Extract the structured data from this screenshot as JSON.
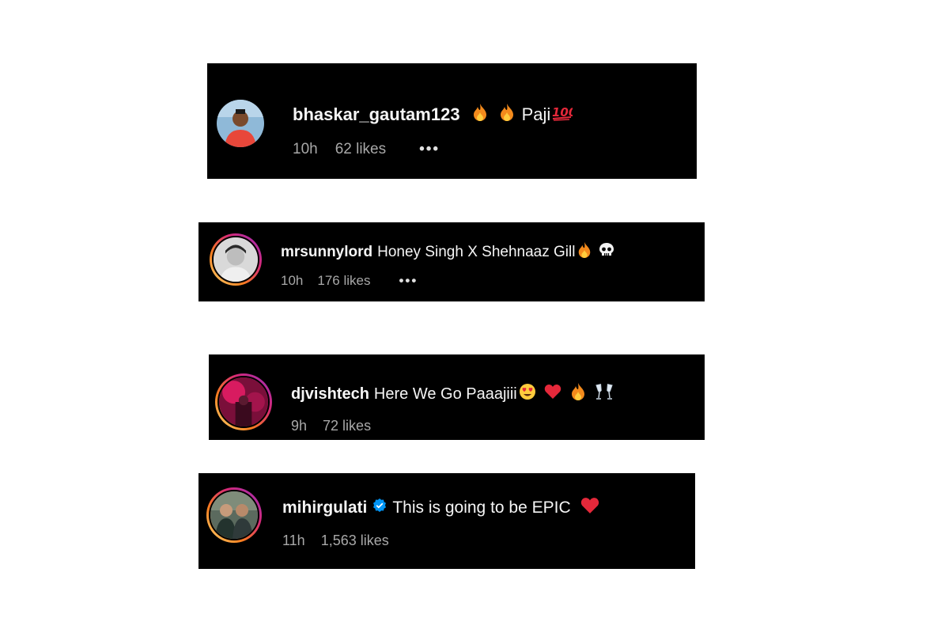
{
  "comments": [
    {
      "username": "bhaskar_gautam123",
      "text": "Paji",
      "emojis_before_text": [
        "fire",
        "fire"
      ],
      "emojis_after_text": [
        "hundred-points"
      ],
      "time": "10h",
      "likes": "62 likes",
      "more": "•••"
    },
    {
      "username": "mrsunnylord",
      "text": "Honey Singh X Shehnaaz Gill",
      "emojis_after_text": [
        "fire",
        "skull"
      ],
      "time": "10h",
      "likes": "176 likes",
      "more": "•••"
    },
    {
      "username": "djvishtech",
      "text": "Here We Go Paaajiii",
      "emojis_after_text": [
        "heart-eyes",
        "red-heart",
        "fire",
        "clinking-glasses"
      ],
      "time": "9h",
      "likes": "72 likes"
    },
    {
      "username": "mihirgulati",
      "verified": true,
      "text": "This is going to be EPIC",
      "emojis_after_text": [
        "red-heart"
      ],
      "time": "11h",
      "likes": "1,563 likes"
    }
  ],
  "colors": {
    "card_bg": "#000000",
    "text": "#f5f5f5",
    "meta": "#a8a8a8",
    "verified": "#0095f6",
    "story_ring_start": "#feda75",
    "story_ring_end": "#d62976"
  }
}
